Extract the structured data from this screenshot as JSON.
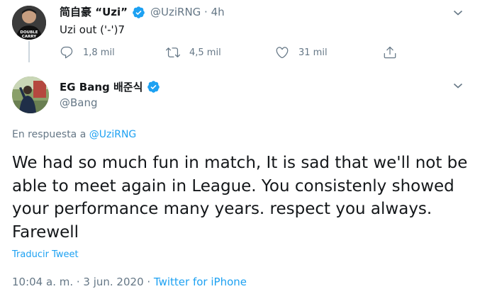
{
  "parent_tweet": {
    "display_name": "简自豪 “Uzi”",
    "handle_time": "@UziRNG · 4h",
    "text": "Uzi out ('-')7",
    "actions": {
      "replies": "1,8 mil",
      "retweets": "4,5 mil",
      "likes": "31 mil"
    },
    "avatar_shirt_text_1": "DOUBLE",
    "avatar_shirt_text_2": "CARRY"
  },
  "main_tweet": {
    "display_name": "EG Bang 배준식",
    "handle": "@Bang",
    "reply_prefix": "En respuesta a ",
    "reply_link": "@UziRNG",
    "text": "We had so much fun in match, It is sad that we'll not be able to meet again in League. You consistenly showed your performance many years. respect you always. Farewell",
    "translate_label": "Traducir Tweet",
    "timestamp": "10:04 a. m. · 3 jun. 2020 · ",
    "source": "Twitter for iPhone"
  },
  "colors": {
    "accent": "#1da1f2",
    "muted": "#657786",
    "text": "#14171a",
    "thread_line": "#ccd6dd"
  }
}
